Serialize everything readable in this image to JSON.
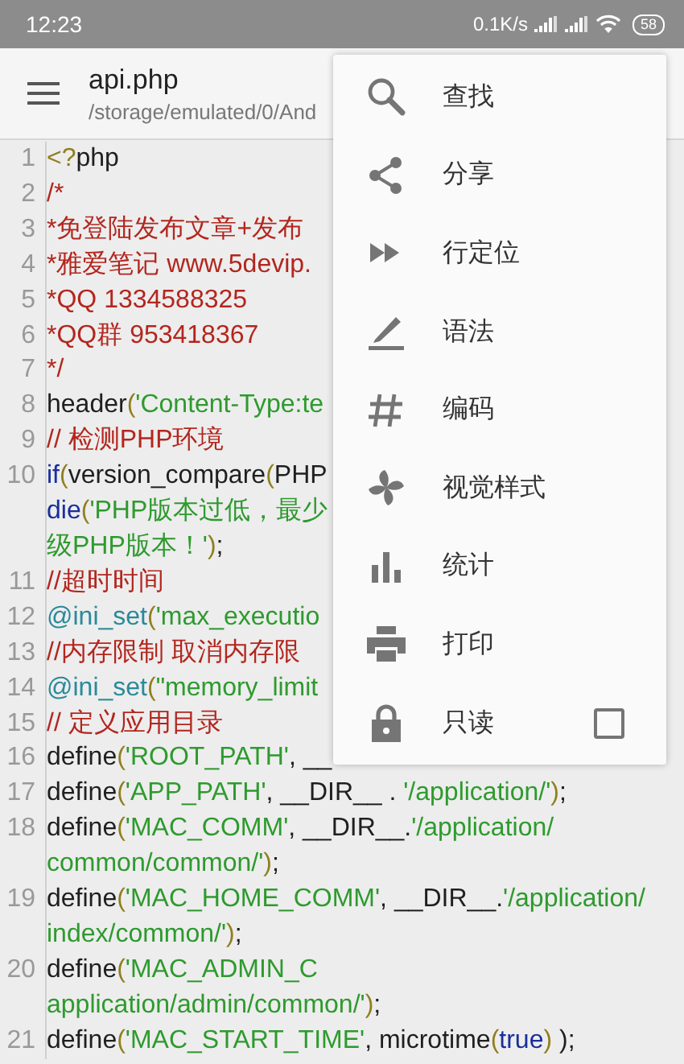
{
  "status_bar": {
    "time": "12:23",
    "speed": "0.1K/s",
    "battery": "58"
  },
  "toolbar": {
    "title": "api.php",
    "path": "/storage/emulated/0/And"
  },
  "code": [
    {
      "number": "1",
      "rows": [
        {
          "tokens": [
            {
              "kind": "tag",
              "text": "<?"
            },
            {
              "kind": "plain",
              "text": "php"
            }
          ]
        }
      ]
    },
    {
      "number": "2",
      "rows": [
        {
          "tokens": [
            {
              "kind": "comment",
              "text": "/*"
            }
          ]
        }
      ]
    },
    {
      "number": "3",
      "rows": [
        {
          "tokens": [
            {
              "kind": "comment",
              "text": "*免登陆发布文章+发布"
            }
          ]
        }
      ]
    },
    {
      "number": "4",
      "rows": [
        {
          "tokens": [
            {
              "kind": "comment",
              "text": "*雅爱笔记 www.5devip."
            }
          ]
        }
      ]
    },
    {
      "number": "5",
      "rows": [
        {
          "tokens": [
            {
              "kind": "comment",
              "text": "*QQ 1334588325"
            }
          ]
        }
      ]
    },
    {
      "number": "6",
      "rows": [
        {
          "tokens": [
            {
              "kind": "comment",
              "text": "*QQ群 953418367"
            }
          ]
        }
      ]
    },
    {
      "number": "7",
      "rows": [
        {
          "tokens": [
            {
              "kind": "comment",
              "text": "*/"
            }
          ]
        }
      ]
    },
    {
      "number": "8",
      "rows": [
        {
          "tokens": [
            {
              "kind": "plain",
              "text": "header"
            },
            {
              "kind": "paren",
              "text": "("
            },
            {
              "kind": "string",
              "text": "'Content-Type:te"
            }
          ]
        }
      ]
    },
    {
      "number": "9",
      "rows": [
        {
          "tokens": [
            {
              "kind": "comment",
              "text": "// 检测PHP环境"
            }
          ]
        }
      ]
    },
    {
      "number": "10",
      "rows": [
        {
          "tokens": [
            {
              "kind": "keyword",
              "text": "if"
            },
            {
              "kind": "paren",
              "text": "("
            },
            {
              "kind": "plain",
              "text": "version_compare"
            },
            {
              "kind": "paren",
              "text": "("
            },
            {
              "kind": "plain",
              "text": "PHP"
            }
          ]
        },
        {
          "tokens": [
            {
              "kind": "keyword",
              "text": "die"
            },
            {
              "kind": "paren",
              "text": "("
            },
            {
              "kind": "string",
              "text": "'PHP版本过低，最少"
            }
          ]
        },
        {
          "tokens": [
            {
              "kind": "string",
              "text": "级PHP版本！'"
            },
            {
              "kind": "paren",
              "text": ")"
            },
            {
              "kind": "plain",
              "text": ";"
            }
          ]
        }
      ]
    },
    {
      "number": "11",
      "rows": [
        {
          "tokens": [
            {
              "kind": "comment",
              "text": "//超时时间"
            }
          ]
        }
      ]
    },
    {
      "number": "12",
      "rows": [
        {
          "tokens": [
            {
              "kind": "function",
              "text": "@ini_set"
            },
            {
              "kind": "paren",
              "text": "("
            },
            {
              "kind": "string",
              "text": "'max_executio"
            }
          ]
        }
      ]
    },
    {
      "number": "13",
      "rows": [
        {
          "tokens": [
            {
              "kind": "comment",
              "text": "//内存限制 取消内存限"
            }
          ]
        }
      ]
    },
    {
      "number": "14",
      "rows": [
        {
          "tokens": [
            {
              "kind": "function",
              "text": "@ini_set"
            },
            {
              "kind": "paren",
              "text": "("
            },
            {
              "kind": "string",
              "text": "\"memory_limit"
            }
          ]
        }
      ]
    },
    {
      "number": "15",
      "rows": [
        {
          "tokens": [
            {
              "kind": "comment",
              "text": "// 定义应用目录"
            }
          ]
        }
      ]
    },
    {
      "number": "16",
      "rows": [
        {
          "tokens": [
            {
              "kind": "plain",
              "text": "define"
            },
            {
              "kind": "paren",
              "text": "("
            },
            {
              "kind": "string",
              "text": "'ROOT_PATH'"
            },
            {
              "kind": "plain",
              "text": ", __"
            }
          ]
        }
      ]
    },
    {
      "number": "17",
      "rows": [
        {
          "tokens": [
            {
              "kind": "plain",
              "text": "define"
            },
            {
              "kind": "paren",
              "text": "("
            },
            {
              "kind": "string",
              "text": "'APP_PATH'"
            },
            {
              "kind": "plain",
              "text": ", __DIR__ . "
            },
            {
              "kind": "string",
              "text": "'/application/'"
            },
            {
              "kind": "paren",
              "text": ")"
            },
            {
              "kind": "plain",
              "text": ";"
            }
          ]
        }
      ]
    },
    {
      "number": "18",
      "rows": [
        {
          "tokens": [
            {
              "kind": "plain",
              "text": "define"
            },
            {
              "kind": "paren",
              "text": "("
            },
            {
              "kind": "string",
              "text": "'MAC_COMM'"
            },
            {
              "kind": "plain",
              "text": ", __DIR__."
            },
            {
              "kind": "string",
              "text": "'/application/"
            }
          ]
        },
        {
          "tokens": [
            {
              "kind": "string",
              "text": "common/common/'"
            },
            {
              "kind": "paren",
              "text": ")"
            },
            {
              "kind": "plain",
              "text": ";"
            }
          ]
        }
      ]
    },
    {
      "number": "19",
      "rows": [
        {
          "tokens": [
            {
              "kind": "plain",
              "text": "define"
            },
            {
              "kind": "paren",
              "text": "("
            },
            {
              "kind": "string",
              "text": "'MAC_HOME_COMM'"
            },
            {
              "kind": "plain",
              "text": ", __DIR__."
            },
            {
              "kind": "string",
              "text": "'/application/"
            }
          ]
        },
        {
          "tokens": [
            {
              "kind": "string",
              "text": "index/common/'"
            },
            {
              "kind": "paren",
              "text": ")"
            },
            {
              "kind": "plain",
              "text": ";"
            }
          ]
        }
      ]
    },
    {
      "number": "20",
      "rows": [
        {
          "tokens": [
            {
              "kind": "plain",
              "text": "define"
            },
            {
              "kind": "paren",
              "text": "("
            },
            {
              "kind": "string",
              "text": "'MAC_ADMIN_C"
            }
          ]
        },
        {
          "tokens": [
            {
              "kind": "string",
              "text": "application/admin/common/'"
            },
            {
              "kind": "paren",
              "text": ")"
            },
            {
              "kind": "plain",
              "text": ";"
            }
          ]
        }
      ]
    },
    {
      "number": "21",
      "rows": [
        {
          "tokens": [
            {
              "kind": "plain",
              "text": "define"
            },
            {
              "kind": "paren",
              "text": "("
            },
            {
              "kind": "string",
              "text": "'MAC_START_TIME'"
            },
            {
              "kind": "plain",
              "text": ", microtime"
            },
            {
              "kind": "paren",
              "text": "("
            },
            {
              "kind": "keyword",
              "text": "true"
            },
            {
              "kind": "paren",
              "text": ")"
            },
            {
              "kind": "plain",
              "text": " );"
            }
          ]
        }
      ]
    }
  ],
  "menu": [
    {
      "kind": "search",
      "label": "查找"
    },
    {
      "kind": "share",
      "label": "分享"
    },
    {
      "kind": "goto",
      "label": "行定位"
    },
    {
      "kind": "syntax",
      "label": "语法"
    },
    {
      "kind": "encoding",
      "label": "编码"
    },
    {
      "kind": "style",
      "label": "视觉样式"
    },
    {
      "kind": "stats",
      "label": "统计"
    },
    {
      "kind": "print",
      "label": "打印"
    },
    {
      "kind": "readonly",
      "label": "只读",
      "checked": false
    }
  ]
}
